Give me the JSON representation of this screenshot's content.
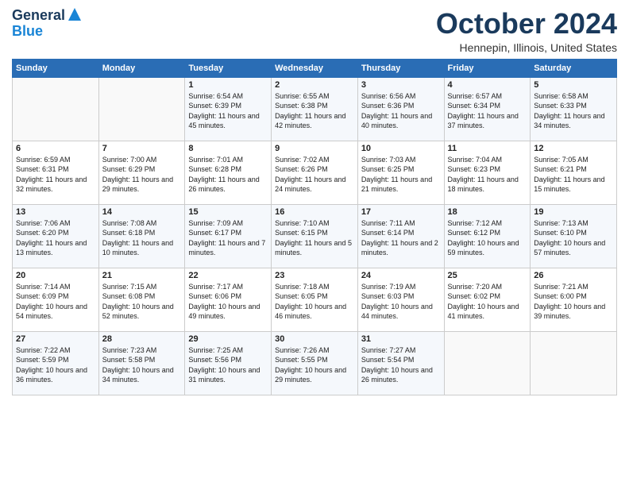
{
  "header": {
    "logo_line1": "General",
    "logo_line2": "Blue",
    "month_title": "October 2024",
    "subtitle": "Hennepin, Illinois, United States"
  },
  "days_of_week": [
    "Sunday",
    "Monday",
    "Tuesday",
    "Wednesday",
    "Thursday",
    "Friday",
    "Saturday"
  ],
  "weeks": [
    [
      {
        "day": "",
        "sunrise": "",
        "sunset": "",
        "daylight": ""
      },
      {
        "day": "",
        "sunrise": "",
        "sunset": "",
        "daylight": ""
      },
      {
        "day": "1",
        "sunrise": "Sunrise: 6:54 AM",
        "sunset": "Sunset: 6:39 PM",
        "daylight": "Daylight: 11 hours and 45 minutes."
      },
      {
        "day": "2",
        "sunrise": "Sunrise: 6:55 AM",
        "sunset": "Sunset: 6:38 PM",
        "daylight": "Daylight: 11 hours and 42 minutes."
      },
      {
        "day": "3",
        "sunrise": "Sunrise: 6:56 AM",
        "sunset": "Sunset: 6:36 PM",
        "daylight": "Daylight: 11 hours and 40 minutes."
      },
      {
        "day": "4",
        "sunrise": "Sunrise: 6:57 AM",
        "sunset": "Sunset: 6:34 PM",
        "daylight": "Daylight: 11 hours and 37 minutes."
      },
      {
        "day": "5",
        "sunrise": "Sunrise: 6:58 AM",
        "sunset": "Sunset: 6:33 PM",
        "daylight": "Daylight: 11 hours and 34 minutes."
      }
    ],
    [
      {
        "day": "6",
        "sunrise": "Sunrise: 6:59 AM",
        "sunset": "Sunset: 6:31 PM",
        "daylight": "Daylight: 11 hours and 32 minutes."
      },
      {
        "day": "7",
        "sunrise": "Sunrise: 7:00 AM",
        "sunset": "Sunset: 6:29 PM",
        "daylight": "Daylight: 11 hours and 29 minutes."
      },
      {
        "day": "8",
        "sunrise": "Sunrise: 7:01 AM",
        "sunset": "Sunset: 6:28 PM",
        "daylight": "Daylight: 11 hours and 26 minutes."
      },
      {
        "day": "9",
        "sunrise": "Sunrise: 7:02 AM",
        "sunset": "Sunset: 6:26 PM",
        "daylight": "Daylight: 11 hours and 24 minutes."
      },
      {
        "day": "10",
        "sunrise": "Sunrise: 7:03 AM",
        "sunset": "Sunset: 6:25 PM",
        "daylight": "Daylight: 11 hours and 21 minutes."
      },
      {
        "day": "11",
        "sunrise": "Sunrise: 7:04 AM",
        "sunset": "Sunset: 6:23 PM",
        "daylight": "Daylight: 11 hours and 18 minutes."
      },
      {
        "day": "12",
        "sunrise": "Sunrise: 7:05 AM",
        "sunset": "Sunset: 6:21 PM",
        "daylight": "Daylight: 11 hours and 15 minutes."
      }
    ],
    [
      {
        "day": "13",
        "sunrise": "Sunrise: 7:06 AM",
        "sunset": "Sunset: 6:20 PM",
        "daylight": "Daylight: 11 hours and 13 minutes."
      },
      {
        "day": "14",
        "sunrise": "Sunrise: 7:08 AM",
        "sunset": "Sunset: 6:18 PM",
        "daylight": "Daylight: 11 hours and 10 minutes."
      },
      {
        "day": "15",
        "sunrise": "Sunrise: 7:09 AM",
        "sunset": "Sunset: 6:17 PM",
        "daylight": "Daylight: 11 hours and 7 minutes."
      },
      {
        "day": "16",
        "sunrise": "Sunrise: 7:10 AM",
        "sunset": "Sunset: 6:15 PM",
        "daylight": "Daylight: 11 hours and 5 minutes."
      },
      {
        "day": "17",
        "sunrise": "Sunrise: 7:11 AM",
        "sunset": "Sunset: 6:14 PM",
        "daylight": "Daylight: 11 hours and 2 minutes."
      },
      {
        "day": "18",
        "sunrise": "Sunrise: 7:12 AM",
        "sunset": "Sunset: 6:12 PM",
        "daylight": "Daylight: 10 hours and 59 minutes."
      },
      {
        "day": "19",
        "sunrise": "Sunrise: 7:13 AM",
        "sunset": "Sunset: 6:10 PM",
        "daylight": "Daylight: 10 hours and 57 minutes."
      }
    ],
    [
      {
        "day": "20",
        "sunrise": "Sunrise: 7:14 AM",
        "sunset": "Sunset: 6:09 PM",
        "daylight": "Daylight: 10 hours and 54 minutes."
      },
      {
        "day": "21",
        "sunrise": "Sunrise: 7:15 AM",
        "sunset": "Sunset: 6:08 PM",
        "daylight": "Daylight: 10 hours and 52 minutes."
      },
      {
        "day": "22",
        "sunrise": "Sunrise: 7:17 AM",
        "sunset": "Sunset: 6:06 PM",
        "daylight": "Daylight: 10 hours and 49 minutes."
      },
      {
        "day": "23",
        "sunrise": "Sunrise: 7:18 AM",
        "sunset": "Sunset: 6:05 PM",
        "daylight": "Daylight: 10 hours and 46 minutes."
      },
      {
        "day": "24",
        "sunrise": "Sunrise: 7:19 AM",
        "sunset": "Sunset: 6:03 PM",
        "daylight": "Daylight: 10 hours and 44 minutes."
      },
      {
        "day": "25",
        "sunrise": "Sunrise: 7:20 AM",
        "sunset": "Sunset: 6:02 PM",
        "daylight": "Daylight: 10 hours and 41 minutes."
      },
      {
        "day": "26",
        "sunrise": "Sunrise: 7:21 AM",
        "sunset": "Sunset: 6:00 PM",
        "daylight": "Daylight: 10 hours and 39 minutes."
      }
    ],
    [
      {
        "day": "27",
        "sunrise": "Sunrise: 7:22 AM",
        "sunset": "Sunset: 5:59 PM",
        "daylight": "Daylight: 10 hours and 36 minutes."
      },
      {
        "day": "28",
        "sunrise": "Sunrise: 7:23 AM",
        "sunset": "Sunset: 5:58 PM",
        "daylight": "Daylight: 10 hours and 34 minutes."
      },
      {
        "day": "29",
        "sunrise": "Sunrise: 7:25 AM",
        "sunset": "Sunset: 5:56 PM",
        "daylight": "Daylight: 10 hours and 31 minutes."
      },
      {
        "day": "30",
        "sunrise": "Sunrise: 7:26 AM",
        "sunset": "Sunset: 5:55 PM",
        "daylight": "Daylight: 10 hours and 29 minutes."
      },
      {
        "day": "31",
        "sunrise": "Sunrise: 7:27 AM",
        "sunset": "Sunset: 5:54 PM",
        "daylight": "Daylight: 10 hours and 26 minutes."
      },
      {
        "day": "",
        "sunrise": "",
        "sunset": "",
        "daylight": ""
      },
      {
        "day": "",
        "sunrise": "",
        "sunset": "",
        "daylight": ""
      }
    ]
  ]
}
